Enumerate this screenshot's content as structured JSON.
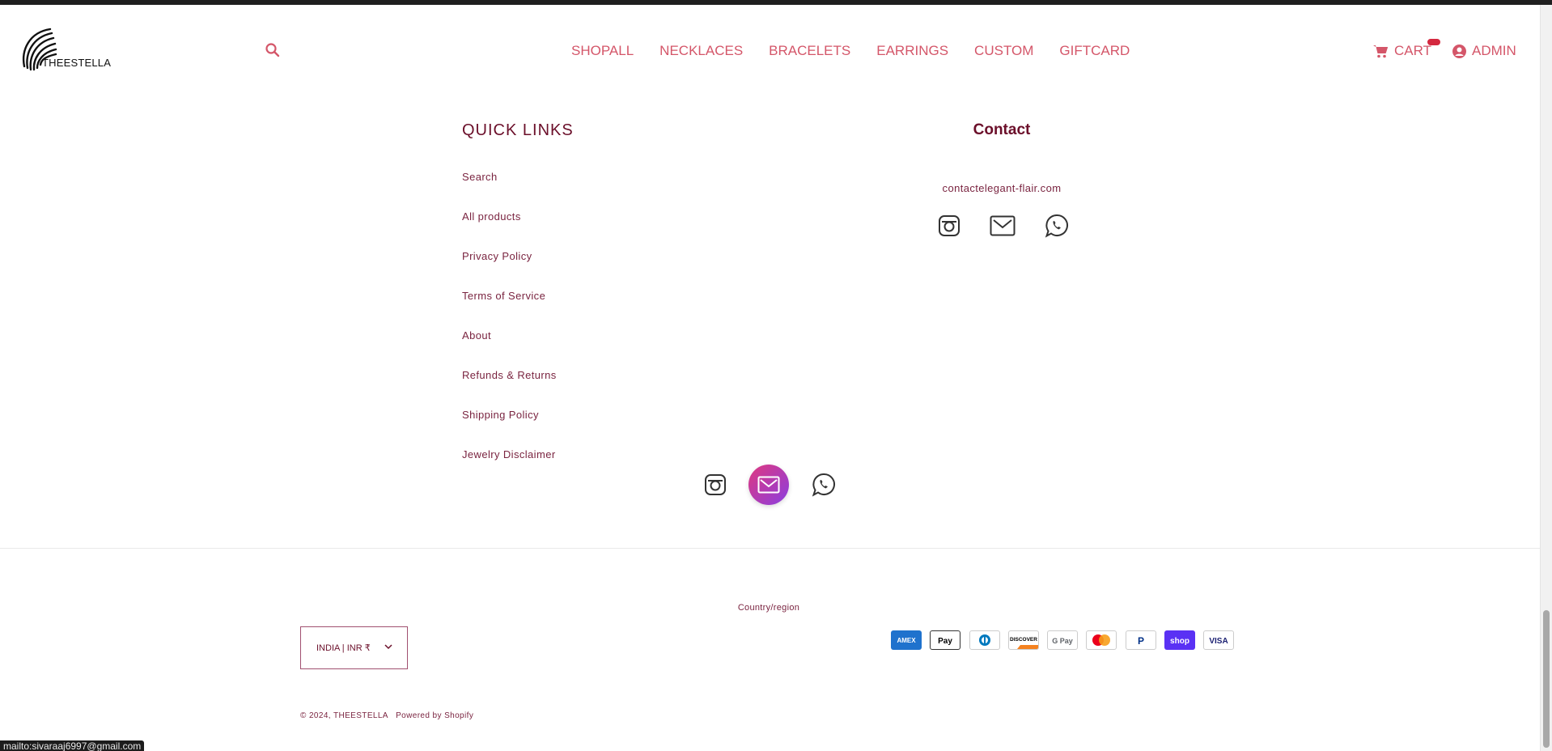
{
  "header": {
    "logo_text": "THEESTELLA",
    "nav": [
      "SHOPALL",
      "NECKLACES",
      "BRACELETS",
      "EARRINGS",
      "CUSTOM",
      "GIFTCARD"
    ],
    "cart_label": "CART",
    "admin_label": "ADMIN"
  },
  "quick_links": {
    "title": "QUICK LINKS",
    "items": [
      "Search",
      "All products",
      "Privacy Policy",
      "Terms of Service",
      "About",
      "Refunds & Returns",
      "Shipping Policy",
      "Jewelry Disclaimer"
    ]
  },
  "contact": {
    "title": "Contact",
    "email": "contactelegant-flair.com",
    "icons": [
      "instagram-icon",
      "mail-icon",
      "whatsapp-icon"
    ]
  },
  "footer": {
    "country_label": "Country/region",
    "country_value": "INDIA | INR ₹",
    "payment_methods": [
      "American Express",
      "Apple Pay",
      "Diners Club",
      "Discover",
      "Google Pay",
      "Mastercard",
      "PayPal",
      "Shop Pay",
      "Visa"
    ],
    "copyright": "© 2024, THEESTELLA",
    "powered_by": "Powered by Shopify"
  },
  "status_bar": "mailto:sivaraaj6997@gmail.com",
  "colors": {
    "accent": "#d45669",
    "heading": "#6b0f2a",
    "text": "#7a2440",
    "badge": "#d4283f"
  }
}
